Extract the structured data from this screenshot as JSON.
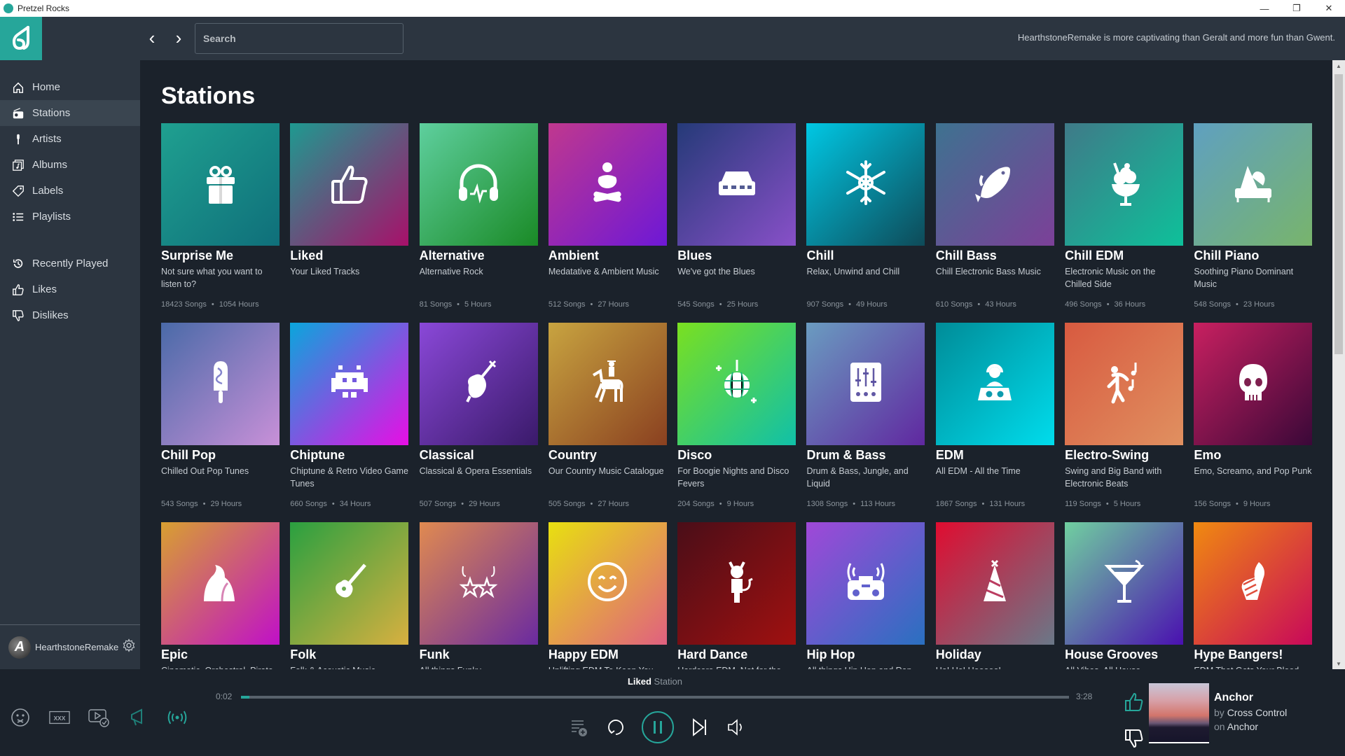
{
  "window": {
    "title": "Pretzel Rocks",
    "minimize": "—",
    "restore": "❐",
    "close": "✕"
  },
  "topbar": {
    "back": "‹",
    "forward": "›",
    "search_placeholder": "Search",
    "marquee": "HearthstoneRemake is more captivating than Geralt and more fun than Gwent."
  },
  "sidebar": {
    "items": [
      {
        "label": "Home",
        "icon": "home-icon"
      },
      {
        "label": "Stations",
        "icon": "radio-icon",
        "active": true
      },
      {
        "label": "Artists",
        "icon": "microphone-icon"
      },
      {
        "label": "Albums",
        "icon": "album-icon"
      },
      {
        "label": "Labels",
        "icon": "tag-icon"
      },
      {
        "label": "Playlists",
        "icon": "list-icon"
      }
    ],
    "history": [
      {
        "label": "Recently Played",
        "icon": "history-icon"
      },
      {
        "label": "Likes",
        "icon": "thumbs-up-icon"
      },
      {
        "label": "Dislikes",
        "icon": "thumbs-down-icon"
      }
    ],
    "user": {
      "name": "HearthstoneRemake",
      "avatar_letter": "A"
    }
  },
  "main": {
    "title": "Stations",
    "stations": [
      {
        "name": "Surprise Me",
        "desc": "Not sure what you want to listen to?",
        "songs": "18423 Songs",
        "hours": "1054 Hours",
        "icon": "gift-icon",
        "colors": [
          "#1fa090",
          "#0f6f7a"
        ]
      },
      {
        "name": "Liked",
        "desc": "Your Liked Tracks",
        "songs": "",
        "hours": "",
        "icon": "thumbs-up-icon",
        "colors": [
          "#1e9a90",
          "#a8106a"
        ]
      },
      {
        "name": "Alternative",
        "desc": "Alternative Rock",
        "songs": "81 Songs",
        "hours": "5 Hours",
        "icon": "headphones-icon",
        "colors": [
          "#5ecf9e",
          "#1a8a26"
        ]
      },
      {
        "name": "Ambient",
        "desc": "Medatative & Ambient Music",
        "songs": "512 Songs",
        "hours": "27 Hours",
        "icon": "meditation-icon",
        "colors": [
          "#c0388e",
          "#6e18d6"
        ]
      },
      {
        "name": "Blues",
        "desc": "We've got the Blues",
        "songs": "545 Songs",
        "hours": "25 Hours",
        "icon": "harmonica-icon",
        "colors": [
          "#253a78",
          "#8850c8"
        ]
      },
      {
        "name": "Chill",
        "desc": "Relax, Unwind and Chill",
        "songs": "907 Songs",
        "hours": "49 Hours",
        "icon": "snowflake-icon",
        "colors": [
          "#00c8e4",
          "#0e4a58"
        ]
      },
      {
        "name": "Chill Bass",
        "desc": "Chill Electronic Bass Music",
        "songs": "610 Songs",
        "hours": "43 Hours",
        "icon": "fish-icon",
        "colors": [
          "#3e7290",
          "#7c4098"
        ]
      },
      {
        "name": "Chill EDM",
        "desc": "Electronic Music on the Chilled Side",
        "songs": "496 Songs",
        "hours": "36 Hours",
        "icon": "ice-cream-sundae-icon",
        "colors": [
          "#3f7a88",
          "#0ec09a"
        ]
      },
      {
        "name": "Chill Piano",
        "desc": "Soothing Piano Dominant Music",
        "songs": "548 Songs",
        "hours": "23 Hours",
        "icon": "grand-piano-icon",
        "colors": [
          "#5fa0c0",
          "#78b46c"
        ]
      },
      {
        "name": "Chill Pop",
        "desc": "Chilled Out Pop Tunes",
        "songs": "543 Songs",
        "hours": "29 Hours",
        "icon": "popsicle-icon",
        "colors": [
          "#4a6aa8",
          "#c890d8"
        ]
      },
      {
        "name": "Chiptune",
        "desc": "Chiptune & Retro Video Game Tunes",
        "songs": "660 Songs",
        "hours": "34 Hours",
        "icon": "space-invader-icon",
        "colors": [
          "#0aa6dc",
          "#e80ee4"
        ]
      },
      {
        "name": "Classical",
        "desc": "Classical & Opera Essentials",
        "songs": "507 Songs",
        "hours": "29 Hours",
        "icon": "violin-icon",
        "colors": [
          "#8a48d8",
          "#3a1a6a"
        ]
      },
      {
        "name": "Country",
        "desc": "Our Country Music Catalogue",
        "songs": "505 Songs",
        "hours": "27 Hours",
        "icon": "horse-rider-icon",
        "colors": [
          "#c8a440",
          "#8a4020"
        ]
      },
      {
        "name": "Disco",
        "desc": "For Boogie Nights and Disco Fevers",
        "songs": "204 Songs",
        "hours": "9 Hours",
        "icon": "disco-ball-icon",
        "colors": [
          "#7ae020",
          "#10c0a8"
        ]
      },
      {
        "name": "Drum & Bass",
        "desc": "Drum & Bass, Jungle, and Liquid",
        "songs": "1308 Songs",
        "hours": "113 Hours",
        "icon": "mixer-sliders-icon",
        "colors": [
          "#6a9cc0",
          "#6028a0"
        ]
      },
      {
        "name": "EDM",
        "desc": "All EDM - All the Time",
        "songs": "1867 Songs",
        "hours": "131 Hours",
        "icon": "dj-icon",
        "colors": [
          "#008c98",
          "#00dcec"
        ]
      },
      {
        "name": "Electro-Swing",
        "desc": "Swing and Big Band with Electronic Beats",
        "songs": "119 Songs",
        "hours": "5 Hours",
        "icon": "dancer-icon",
        "colors": [
          "#d85a40",
          "#e09060"
        ]
      },
      {
        "name": "Emo",
        "desc": "Emo, Screamo, and Pop Punk",
        "songs": "156 Songs",
        "hours": "9 Hours",
        "icon": "skull-icon",
        "colors": [
          "#c82060",
          "#3a0838"
        ]
      },
      {
        "name": "Epic",
        "desc": "Cinematic, Orchestral, Pirate",
        "songs": "",
        "hours": "",
        "icon": "mountain-icon",
        "colors": [
          "#d8a030",
          "#c010c8"
        ]
      },
      {
        "name": "Folk",
        "desc": "Folk & Acoustic Music",
        "songs": "",
        "hours": "",
        "icon": "guitar-icon",
        "colors": [
          "#2aa040",
          "#d8b040"
        ]
      },
      {
        "name": "Funk",
        "desc": "All things Funky",
        "songs": "",
        "hours": "",
        "icon": "star-glasses-icon",
        "colors": [
          "#e08a50",
          "#6a2aa0"
        ]
      },
      {
        "name": "Happy EDM",
        "desc": "Uplifting EDM To Keep You",
        "songs": "",
        "hours": "",
        "icon": "smiley-icon",
        "colors": [
          "#e8e010",
          "#e06080"
        ]
      },
      {
        "name": "Hard Dance",
        "desc": "Hardcore EDM, Not for the",
        "songs": "",
        "hours": "",
        "icon": "devil-icon",
        "colors": [
          "#4a0e18",
          "#a01010"
        ]
      },
      {
        "name": "Hip Hop",
        "desc": "All things Hip Hop and Rap",
        "songs": "",
        "hours": "",
        "icon": "boombox-icon",
        "colors": [
          "#a048d8",
          "#2a70c0"
        ]
      },
      {
        "name": "Holiday",
        "desc": "Ho! Ho! Hooooo!",
        "songs": "",
        "hours": "",
        "icon": "party-hat-icon",
        "colors": [
          "#e00c30",
          "#6a7888"
        ]
      },
      {
        "name": "House Grooves",
        "desc": "All Vibes, All House",
        "songs": "",
        "hours": "",
        "icon": "cocktail-icon",
        "colors": [
          "#70d0a0",
          "#4a10b0"
        ]
      },
      {
        "name": "Hype Bangers!",
        "desc": "EDM That Gets Your Blood",
        "songs": "",
        "hours": "",
        "icon": "fist-icon",
        "colors": [
          "#f08a10",
          "#c8085a"
        ]
      }
    ]
  },
  "player": {
    "source_bold": "Liked",
    "source_rest": "Station",
    "elapsed": "0:02",
    "duration": "3:28",
    "progress": 0.01,
    "track": {
      "title": "Anchor",
      "by_label": "by",
      "artist": "Cross Control",
      "on_label": "on",
      "album": "Anchor"
    },
    "accent": "#26a69a"
  }
}
